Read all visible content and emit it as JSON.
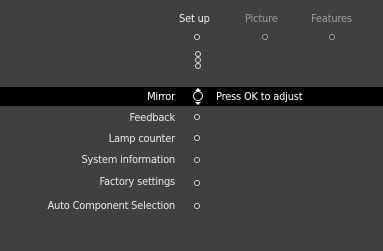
{
  "tabs": [
    {
      "label": "Set up",
      "active": true
    },
    {
      "label": "Picture",
      "active": false
    },
    {
      "label": "Features",
      "active": false
    }
  ],
  "menu": {
    "items": [
      {
        "label": "Mirror",
        "selected": true
      },
      {
        "label": "Feedback",
        "selected": false
      },
      {
        "label": "Lamp counter",
        "selected": false
      },
      {
        "label": "System information",
        "selected": false
      },
      {
        "label": "Factory settings",
        "selected": false
      },
      {
        "label": "Auto Component Selection",
        "selected": false
      }
    ],
    "hint": "Press OK to adjust"
  },
  "icons": {
    "tab_indicator": "radio-circle-icon",
    "submenu_indicator": "submenu-dots-icon",
    "navigate": "navigate-up-down-icon",
    "item_indicator": "radio-circle-icon"
  },
  "colors": {
    "background": "#404040",
    "highlight": "#000000",
    "text": "#e6e6e6",
    "text_dim": "#9a9a9a"
  }
}
